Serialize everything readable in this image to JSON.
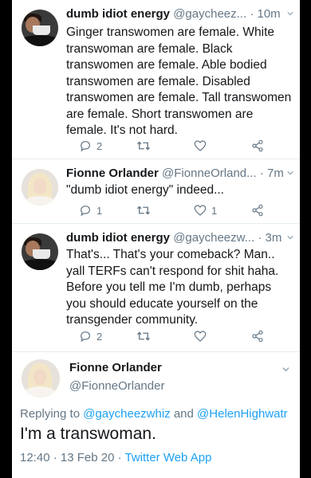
{
  "tweets": [
    {
      "name": "dumb idiot energy",
      "handle": "@gaycheez...",
      "time": "· 10m",
      "text": "Ginger transwomen are female. White transwoman are female. Black transwomen are female. Able bodied transwomen are female. Disabled transwomen are female. Tall transwomen are female. Short transwomen are female. It's not hard.",
      "replies": "2",
      "retweets": "",
      "likes": ""
    },
    {
      "name": "Fionne Orlander",
      "handle": "@FionneOrland...",
      "time": "· 7m",
      "text": "\"dumb idiot energy\" indeed...",
      "replies": "1",
      "retweets": "",
      "likes": "1"
    },
    {
      "name": "dumb idiot energy",
      "handle": "@gaycheezw...",
      "time": "· 3m",
      "text": "That's... That's your comeback? Man.. yall TERFs can't respond for shit haha. Before you tell me I'm dumb, perhaps you should educate yourself on the transgender community.",
      "replies": "2",
      "retweets": "",
      "likes": ""
    }
  ],
  "focused": {
    "name": "Fionne Orlander",
    "handle": "@FionneOrlander",
    "replying_prefix": "Replying to ",
    "replying_user1": "@gaycheezwhiz",
    "replying_and": " and ",
    "replying_user2": "@HelenHighwatr",
    "text": "I'm a transwoman.",
    "timestamp": "12:40 · 13 Feb 20 · ",
    "source": "Twitter Web App"
  },
  "icons": [
    "reply-icon",
    "retweet-icon",
    "like-icon",
    "share-icon",
    "chevron-down-icon"
  ],
  "colors": {
    "link": "#1da1f2",
    "secondary": "#657786",
    "text": "#14171a",
    "divider": "#e6ecf0"
  }
}
